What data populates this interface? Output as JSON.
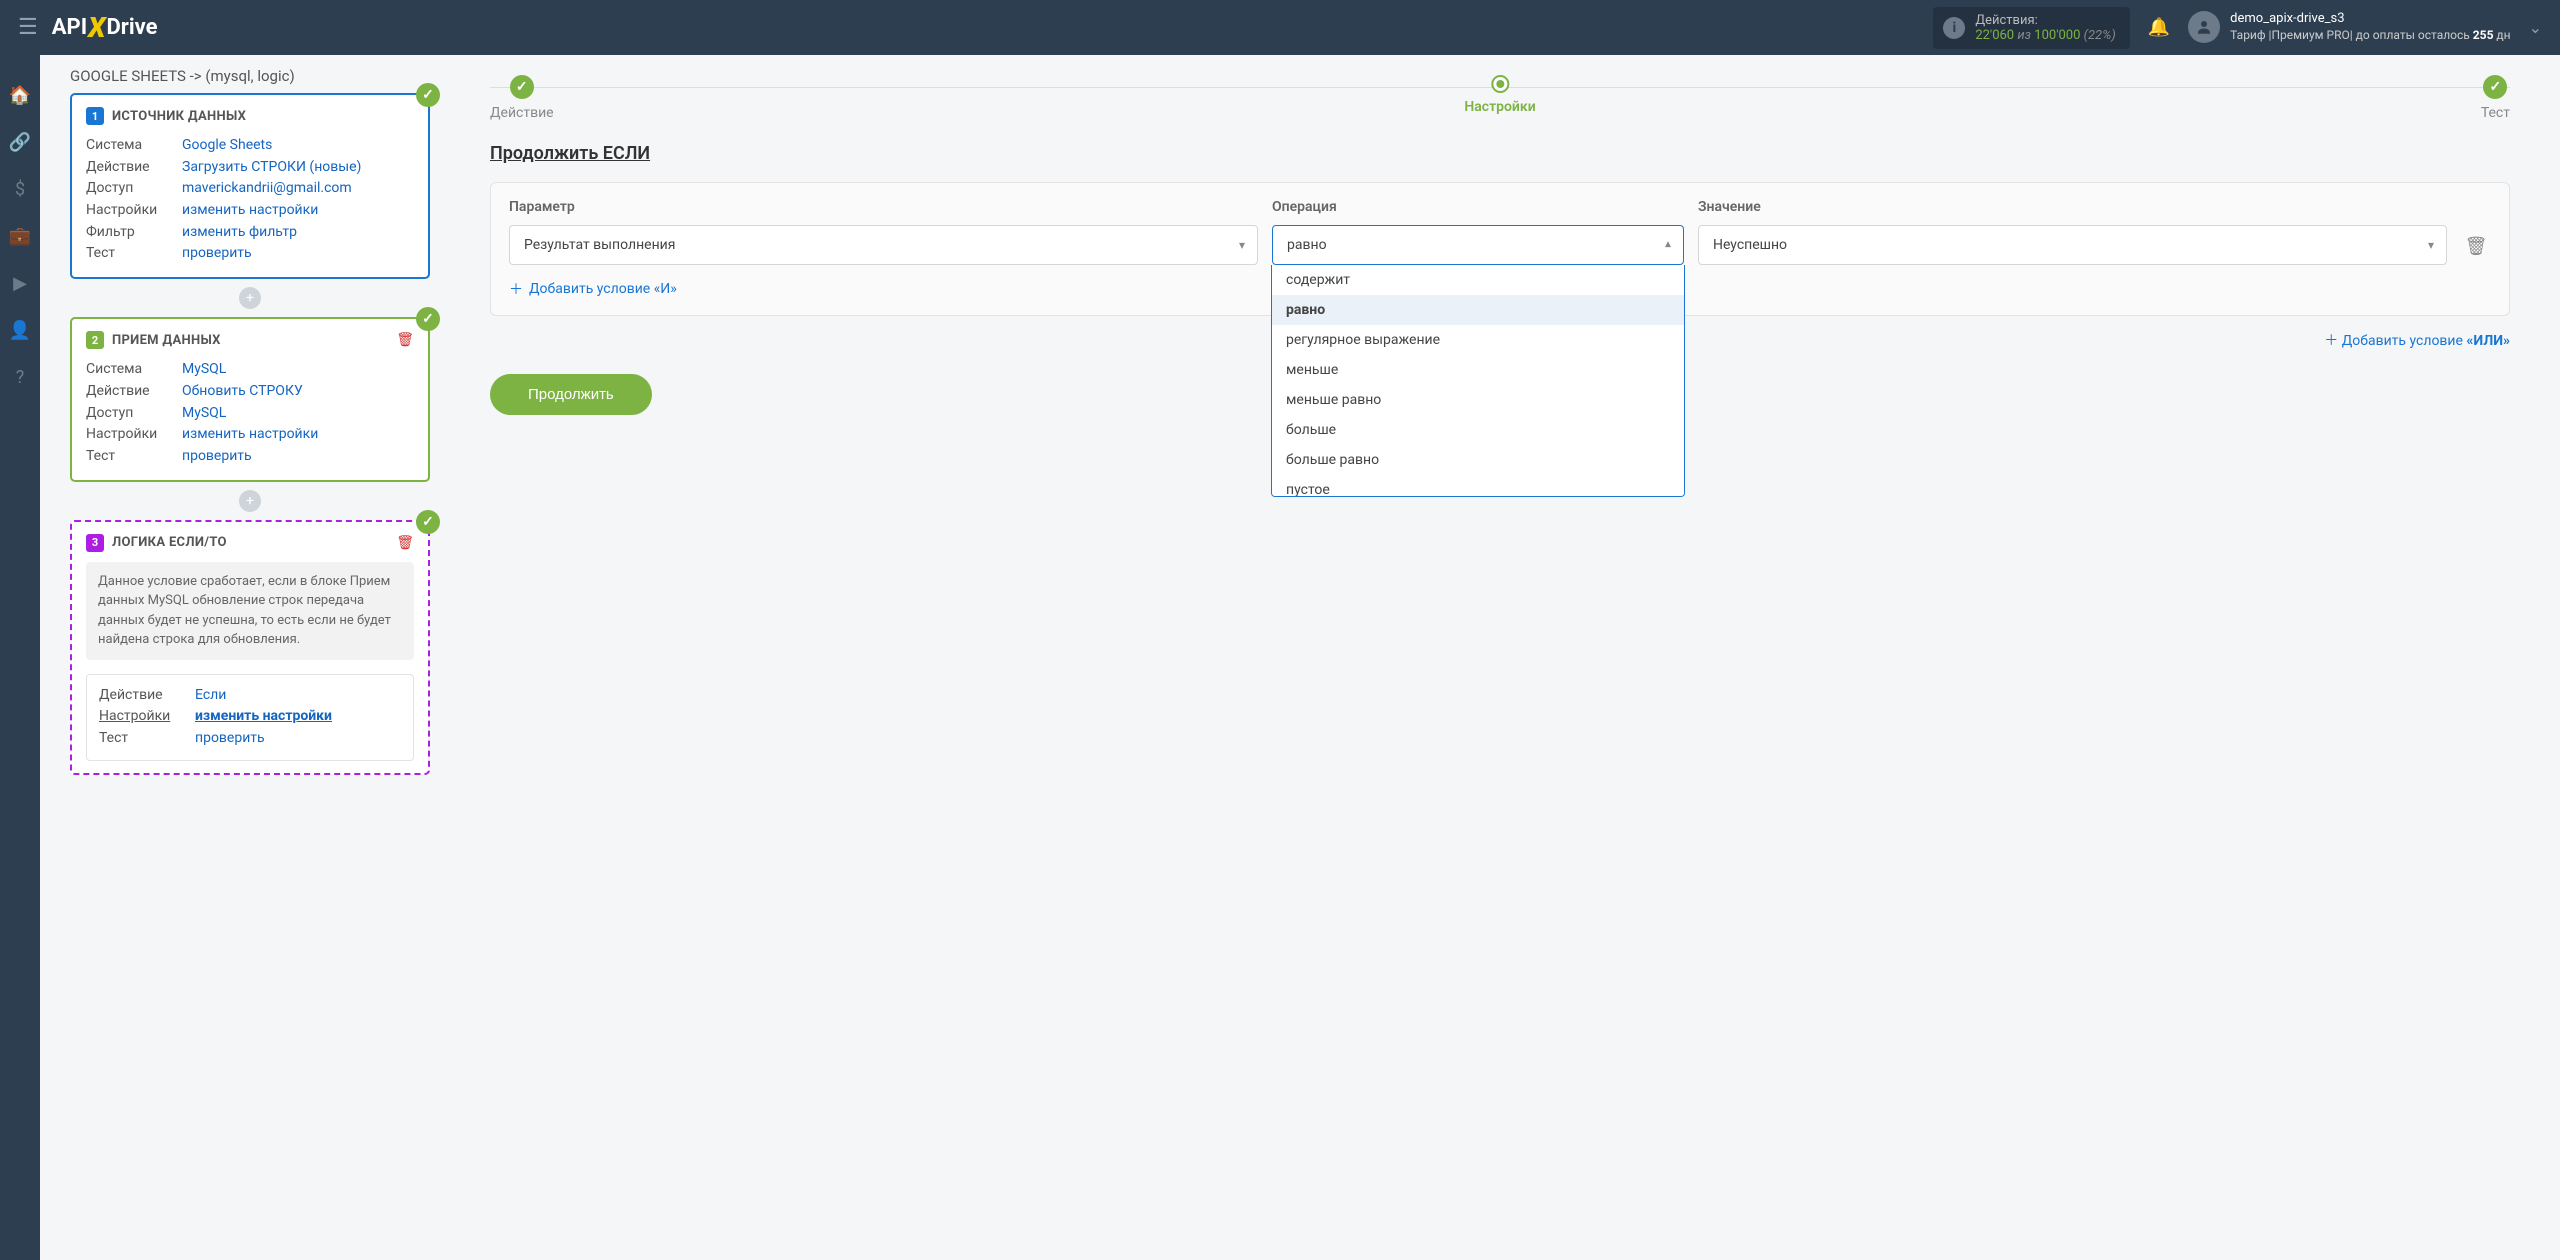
{
  "header": {
    "logo_pre": "API",
    "logo_x": "X",
    "logo_post": "Drive",
    "actions_label": "Действия:",
    "actions_used": "22'060",
    "actions_of": "из",
    "actions_total": "100'000",
    "actions_pct": "(22%)",
    "user_name": "demo_apix-drive_s3",
    "tariff_pre": "Тариф |Премиум PRO| до оплаты осталось ",
    "tariff_days": "255",
    "tariff_post": " дн"
  },
  "breadcrumb": "GOOGLE SHEETS -> (mysql, logic)",
  "block1": {
    "title": "ИСТОЧНИК ДАННЫХ",
    "rows": {
      "system_k": "Система",
      "system_v": "Google Sheets",
      "action_k": "Действие",
      "action_v": "Загрузить СТРОКИ (новые)",
      "access_k": "Доступ",
      "access_v": "maverickandrii@gmail.com",
      "settings_k": "Настройки",
      "settings_v": "изменить настройки",
      "filter_k": "Фильтр",
      "filter_v": "изменить фильтр",
      "test_k": "Тест",
      "test_v": "проверить"
    }
  },
  "block2": {
    "title": "ПРИЕМ ДАННЫХ",
    "rows": {
      "system_k": "Система",
      "system_v": "MySQL",
      "action_k": "Действие",
      "action_v": "Обновить СТРОКУ",
      "access_k": "Доступ",
      "access_v": "MySQL",
      "settings_k": "Настройки",
      "settings_v": "изменить настройки",
      "test_k": "Тест",
      "test_v": "проверить"
    }
  },
  "block3": {
    "title": "ЛОГИКА ЕСЛИ/ТО",
    "info": "Данное условие сработает, если в блоке Прием данных MySQL обновление строк передача данных будет не успешна, то есть если не будет найдена строка для обновления.",
    "rows": {
      "action_k": "Действие",
      "action_v": "Если",
      "settings_k": "Настройки",
      "settings_v": "изменить настройки",
      "test_k": "Тест",
      "test_v": "проверить"
    }
  },
  "stepper": {
    "s1": "Действие",
    "s2": "Настройки",
    "s3": "Тест"
  },
  "main": {
    "section_title": "Продолжить ЕСЛИ",
    "param_hdr": "Параметр",
    "op_hdr": "Операция",
    "val_hdr": "Значение",
    "param_val": "Результат выполнения",
    "op_val": "равно",
    "val_val": "Неуспешно",
    "add_and": "Добавить условие «И»",
    "add_or_pre": "Добавить условие ",
    "add_or_bold": "«ИЛИ»",
    "continue": "Продолжить"
  },
  "op_options": [
    "содержит",
    "равно",
    "регулярное выражение",
    "меньше",
    "меньше равно",
    "больше",
    "больше равно",
    "пустое"
  ],
  "op_selected": "равно"
}
